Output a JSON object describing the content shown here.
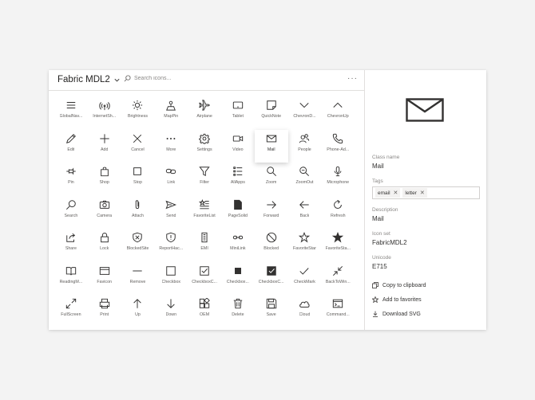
{
  "header": {
    "title": "Fabric MDL2",
    "search_placeholder": "Search icons...",
    "more_label": "···"
  },
  "icons": [
    {
      "label": "GlobalNav...",
      "icon": "global-nav-icon"
    },
    {
      "label": "InternetSh...",
      "icon": "internet-sharing-icon"
    },
    {
      "label": "Brightness",
      "icon": "brightness-icon"
    },
    {
      "label": "MapPin",
      "icon": "map-pin-icon"
    },
    {
      "label": "Airplane",
      "icon": "airplane-icon"
    },
    {
      "label": "Tablet",
      "icon": "tablet-icon"
    },
    {
      "label": "QuickNote",
      "icon": "quick-note-icon"
    },
    {
      "label": "ChevronD...",
      "icon": "chevron-down-icon"
    },
    {
      "label": "ChevronUp",
      "icon": "chevron-up-icon"
    },
    {
      "label": "Edit",
      "icon": "edit-icon"
    },
    {
      "label": "Add",
      "icon": "add-icon"
    },
    {
      "label": "Cancel",
      "icon": "cancel-icon"
    },
    {
      "label": "More",
      "icon": "more-icon"
    },
    {
      "label": "Settings",
      "icon": "settings-icon"
    },
    {
      "label": "Video",
      "icon": "video-icon"
    },
    {
      "label": "Mail",
      "icon": "mail-icon"
    },
    {
      "label": "People",
      "icon": "people-icon"
    },
    {
      "label": "Phone-Ad...",
      "icon": "phone-icon"
    },
    {
      "label": "Pin",
      "icon": "pin-icon"
    },
    {
      "label": "Shop",
      "icon": "shop-icon"
    },
    {
      "label": "Stop",
      "icon": "stop-icon"
    },
    {
      "label": "Link",
      "icon": "link-icon"
    },
    {
      "label": "Filter",
      "icon": "filter-icon"
    },
    {
      "label": "AllApps",
      "icon": "all-apps-icon"
    },
    {
      "label": "Zoom",
      "icon": "zoom-icon"
    },
    {
      "label": "ZoomOut",
      "icon": "zoom-out-icon"
    },
    {
      "label": "Microphone",
      "icon": "microphone-icon"
    },
    {
      "label": "Search",
      "icon": "search-icon"
    },
    {
      "label": "Camera",
      "icon": "camera-icon"
    },
    {
      "label": "Attach",
      "icon": "attach-icon"
    },
    {
      "label": "Send",
      "icon": "send-icon"
    },
    {
      "label": "FavoriteList",
      "icon": "favorite-list-icon"
    },
    {
      "label": "PageSolid",
      "icon": "page-solid-icon"
    },
    {
      "label": "Forward",
      "icon": "forward-icon"
    },
    {
      "label": "Back",
      "icon": "back-icon"
    },
    {
      "label": "Refresh",
      "icon": "refresh-icon"
    },
    {
      "label": "Share",
      "icon": "share-icon"
    },
    {
      "label": "Lock",
      "icon": "lock-icon"
    },
    {
      "label": "BlockedSite",
      "icon": "blocked-site-icon"
    },
    {
      "label": "ReportHac...",
      "icon": "report-hacked-icon"
    },
    {
      "label": "EMI",
      "icon": "emi-icon"
    },
    {
      "label": "MiniLink",
      "icon": "mini-link-icon"
    },
    {
      "label": "Blocked",
      "icon": "blocked-icon"
    },
    {
      "label": "FavoriteStar",
      "icon": "favorite-star-icon"
    },
    {
      "label": "FavoriteSta...",
      "icon": "favorite-star-fill-icon"
    },
    {
      "label": "ReadingM...",
      "icon": "reading-mode-icon"
    },
    {
      "label": "Favicon",
      "icon": "favicon-icon"
    },
    {
      "label": "Remove",
      "icon": "remove-icon"
    },
    {
      "label": "Checkbox",
      "icon": "checkbox-icon"
    },
    {
      "label": "CheckboxC...",
      "icon": "checkbox-composite-icon"
    },
    {
      "label": "Checkbox...",
      "icon": "checkbox-fill-icon"
    },
    {
      "label": "CheckboxC...",
      "icon": "checkbox-composite-reversed-icon"
    },
    {
      "label": "CheckMark",
      "icon": "check-mark-icon"
    },
    {
      "label": "BackToWin...",
      "icon": "back-to-window-icon"
    },
    {
      "label": "FullScreen",
      "icon": "full-screen-icon"
    },
    {
      "label": "Print",
      "icon": "print-icon"
    },
    {
      "label": "Up",
      "icon": "up-icon"
    },
    {
      "label": "Down",
      "icon": "down-icon"
    },
    {
      "label": "OEM",
      "icon": "oem-icon"
    },
    {
      "label": "Delete",
      "icon": "delete-icon"
    },
    {
      "label": "Save",
      "icon": "save-icon"
    },
    {
      "label": "Cloud",
      "icon": "cloud-icon"
    },
    {
      "label": "Command...",
      "icon": "command-prompt-icon"
    }
  ],
  "selected_index": 15,
  "details": {
    "class_name_label": "Class name",
    "class_name_value": "Mail",
    "tags_label": "Tags",
    "tags": [
      "email",
      "letter"
    ],
    "description_label": "Description",
    "description_value": "Mail",
    "icon_set_label": "Icon set",
    "icon_set_value": "FabricMDL2",
    "unicode_label": "Unicode",
    "unicode_value": "E715",
    "copy_label": "Copy to clipboard",
    "favorite_label": "Add to favorites",
    "download_label": "Download SVG"
  }
}
